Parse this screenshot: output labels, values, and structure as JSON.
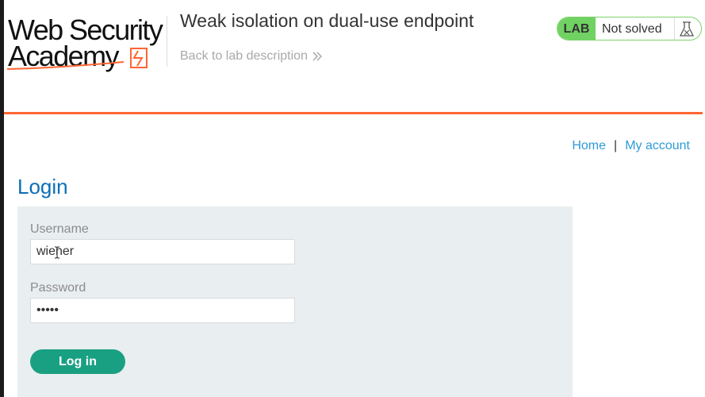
{
  "logo": {
    "line1": "Web Security",
    "line2": "Academy"
  },
  "header": {
    "lab_title": "Weak isolation on dual-use endpoint",
    "back_link": "Back to lab description"
  },
  "status": {
    "badge": "LAB",
    "text": "Not solved",
    "icon": "flask-icon"
  },
  "nav": {
    "home": "Home",
    "separator": "|",
    "my_account": "My account"
  },
  "page": {
    "title": "Login"
  },
  "form": {
    "username_label": "Username",
    "username_value": "wiener",
    "password_label": "Password",
    "password_value": "peter",
    "submit_label": "Log in"
  },
  "colors": {
    "accent_orange": "#ff6633",
    "status_green": "#70d263",
    "link_blue": "#2f9bd6",
    "title_blue": "#0a6fb6",
    "button_teal": "#19a082",
    "panel_bg": "#e9eef0"
  }
}
